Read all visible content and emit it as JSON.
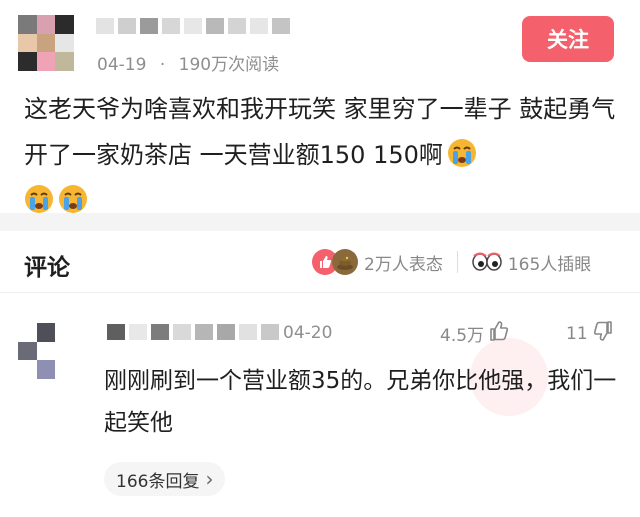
{
  "post": {
    "date": "04-19",
    "separator": "·",
    "views": "190万次阅读",
    "follow_label": "关注",
    "text": "这老天爷为啥喜欢和我开玩笑  家里穷了一辈子  鼓起勇气开了一家奶茶店  一天营业额150 150啊",
    "emojis": [
      "crying-face-icon",
      "crying-face-icon",
      "crying-face-icon"
    ]
  },
  "comments_header": {
    "title": "评论",
    "reactions_count": "2万人表态",
    "peek_count": "165人插眼"
  },
  "comment": {
    "date": "04-20",
    "likes": "4.5万",
    "dislikes": "11",
    "text": "刚刚刷到一个营业额35的。兄弟你比他强，我们一起笑他",
    "replies_label": "166条回复",
    "replies_chevron": "›"
  },
  "colors": {
    "accent": "#f4606c",
    "muted_text": "#8e8e8e",
    "band": "#f4f4f4"
  },
  "icons": [
    "thumbs-up-reaction-icon",
    "poop-reaction-icon",
    "eyes-icon",
    "thumbs-up-icon",
    "thumbs-down-icon",
    "chevron-right-icon"
  ]
}
